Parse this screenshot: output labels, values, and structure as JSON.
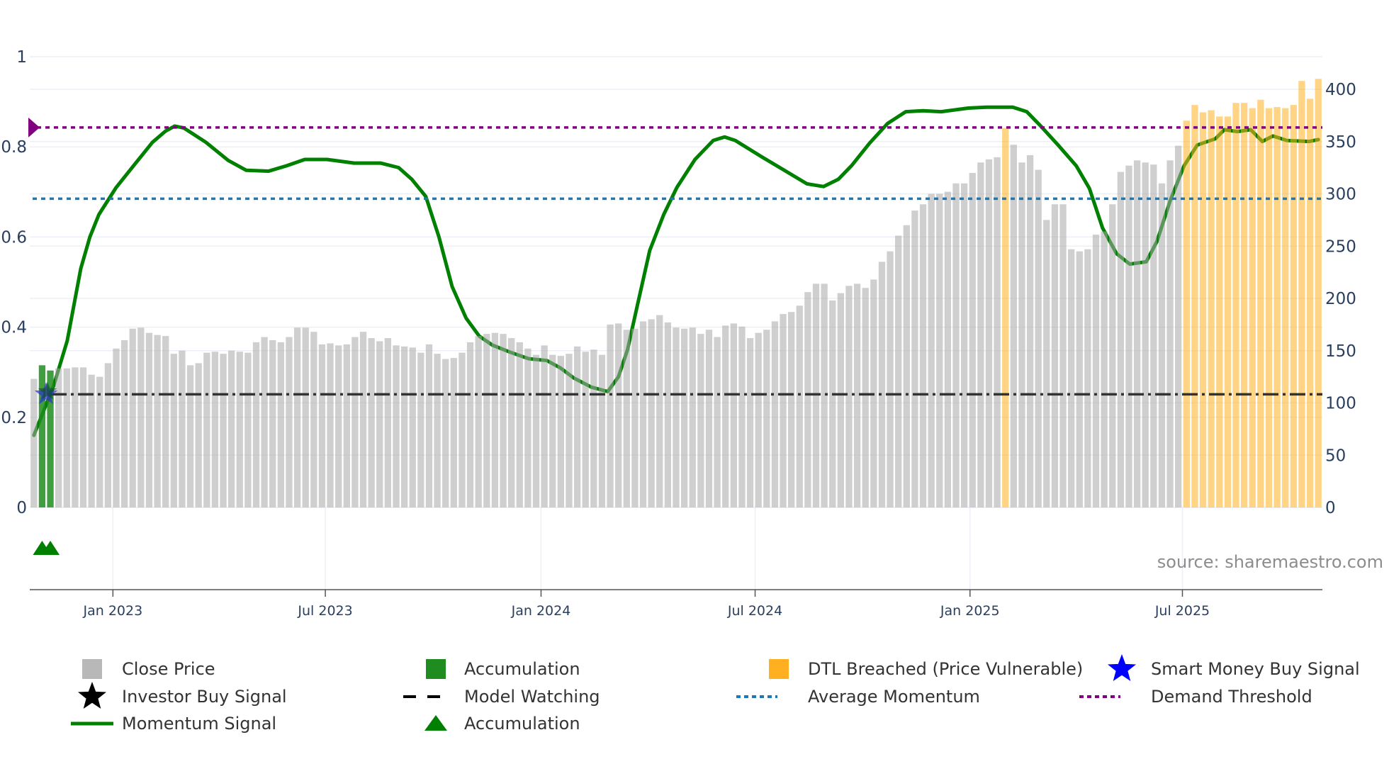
{
  "chart_data": {
    "type": "bar",
    "title": "",
    "source": "source: sharemaestro.com",
    "left_axis": {
      "range": [
        0,
        1
      ],
      "ticks": [
        "0",
        "0.2",
        "0.4",
        "0.6",
        "0.8",
        "1"
      ],
      "tick_values": [
        0,
        0.2,
        0.4,
        0.6,
        0.8,
        1
      ]
    },
    "right_axis": {
      "range": [
        0,
        400
      ],
      "ticks": [
        "0",
        "50",
        "100",
        "150",
        "200",
        "250",
        "300",
        "350",
        "400"
      ],
      "tick_values": [
        0,
        50,
        100,
        150,
        200,
        250,
        300,
        350,
        400
      ]
    },
    "x_ticks": [
      {
        "label": "Jan 2023",
        "index": 9.6
      },
      {
        "label": "Jul 2023",
        "index": 35.4
      },
      {
        "label": "Jan 2024",
        "index": 61.6
      },
      {
        "label": "Jul 2024",
        "index": 87.6
      },
      {
        "label": "Jan 2025",
        "index": 113.7
      },
      {
        "label": "Jul 2025",
        "index": 139.5
      }
    ],
    "close_price": [
      123,
      136,
      131,
      133,
      133,
      134,
      134,
      127,
      125,
      138,
      152,
      160,
      171,
      172,
      167,
      165,
      164,
      147,
      150,
      136,
      138,
      148,
      149,
      147,
      150,
      149,
      148,
      158,
      163,
      160,
      158,
      163,
      172,
      172,
      168,
      156,
      157,
      155,
      156,
      163,
      168,
      162,
      159,
      162,
      155,
      154,
      153,
      148,
      156,
      147,
      142,
      143,
      148,
      158,
      164,
      166,
      167,
      166,
      162,
      158,
      152,
      146,
      155,
      146,
      145,
      147,
      154,
      149,
      151,
      146,
      175,
      176,
      170,
      171,
      178,
      180,
      184,
      177,
      172,
      171,
      172,
      166,
      170,
      163,
      174,
      176,
      173,
      162,
      167,
      170,
      178,
      185,
      187,
      193,
      206,
      214,
      214,
      198,
      205,
      212,
      214,
      210,
      218,
      235,
      245,
      260,
      270,
      284,
      290,
      300,
      300,
      302,
      310,
      310,
      320,
      330,
      333,
      335,
      363,
      347,
      330,
      337,
      323,
      275,
      290,
      290,
      247,
      245,
      247,
      261,
      264,
      290,
      321,
      327,
      332,
      330,
      328,
      310,
      332,
      346,
      370,
      385,
      378,
      380,
      374,
      374,
      387,
      387,
      382,
      390,
      382,
      383,
      382,
      385,
      408,
      391,
      410
    ],
    "accumulation_bars": [
      1,
      2
    ],
    "dtl_breached_bars": [
      118,
      140,
      141,
      142,
      143,
      144,
      145,
      146,
      147,
      148,
      149,
      150,
      151,
      152,
      153,
      154,
      155,
      156
    ],
    "momentum_signal": [
      [
        0,
        0.16
      ],
      [
        2.4,
        0.27
      ],
      [
        4.05,
        0.37
      ],
      [
        5.7,
        0.53
      ],
      [
        6.8,
        0.6
      ],
      [
        7.9,
        0.65
      ],
      [
        10,
        0.71
      ],
      [
        12.2,
        0.76
      ],
      [
        14.4,
        0.81
      ],
      [
        16,
        0.835
      ],
      [
        17.1,
        0.846
      ],
      [
        18.2,
        0.842
      ],
      [
        20.9,
        0.81
      ],
      [
        23.6,
        0.77
      ],
      [
        25.8,
        0.748
      ],
      [
        28.5,
        0.746
      ],
      [
        30.7,
        0.758
      ],
      [
        32.9,
        0.772
      ],
      [
        35.6,
        0.772
      ],
      [
        38.9,
        0.764
      ],
      [
        42.1,
        0.764
      ],
      [
        44.3,
        0.754
      ],
      [
        45.9,
        0.728
      ],
      [
        47.6,
        0.69
      ],
      [
        49.2,
        0.6
      ],
      [
        50.8,
        0.49
      ],
      [
        52.5,
        0.42
      ],
      [
        54.1,
        0.38
      ],
      [
        55.7,
        0.36
      ],
      [
        57.9,
        0.344
      ],
      [
        60.1,
        0.33
      ],
      [
        62.3,
        0.326
      ],
      [
        63.9,
        0.31
      ],
      [
        65.6,
        0.287
      ],
      [
        67.7,
        0.267
      ],
      [
        69.7,
        0.257
      ],
      [
        71,
        0.29
      ],
      [
        72.1,
        0.35
      ],
      [
        73.2,
        0.44
      ],
      [
        74.8,
        0.57
      ],
      [
        76.5,
        0.65
      ],
      [
        78.1,
        0.71
      ],
      [
        80.3,
        0.772
      ],
      [
        82.5,
        0.814
      ],
      [
        83.9,
        0.822
      ],
      [
        85.2,
        0.814
      ],
      [
        88.4,
        0.778
      ],
      [
        91.7,
        0.742
      ],
      [
        93.9,
        0.718
      ],
      [
        95.9,
        0.712
      ],
      [
        97.7,
        0.728
      ],
      [
        99.3,
        0.758
      ],
      [
        101.5,
        0.808
      ],
      [
        103.7,
        0.852
      ],
      [
        105.9,
        0.878
      ],
      [
        108,
        0.88
      ],
      [
        110.2,
        0.878
      ],
      [
        113.5,
        0.886
      ],
      [
        115.7,
        0.888
      ],
      [
        118.9,
        0.888
      ],
      [
        120.6,
        0.878
      ],
      [
        122.2,
        0.848
      ],
      [
        124.4,
        0.804
      ],
      [
        126.6,
        0.758
      ],
      [
        128.2,
        0.708
      ],
      [
        129.8,
        0.62
      ],
      [
        131.5,
        0.563
      ],
      [
        133.1,
        0.54
      ],
      [
        135.1,
        0.545
      ],
      [
        136.4,
        0.59
      ],
      [
        138,
        0.68
      ],
      [
        139.7,
        0.758
      ],
      [
        141.3,
        0.804
      ],
      [
        143.5,
        0.818
      ],
      [
        144.6,
        0.838
      ],
      [
        146.2,
        0.834
      ],
      [
        147.8,
        0.838
      ],
      [
        149.2,
        0.812
      ],
      [
        150.5,
        0.824
      ],
      [
        152.2,
        0.814
      ],
      [
        154.9,
        0.812
      ],
      [
        156,
        0.816
      ]
    ],
    "demand_threshold": 0.843,
    "average_momentum": 0.685,
    "model_watching": 0.251,
    "smart_money_buy_signal": {
      "index": 2,
      "value": 0.251
    },
    "investor_buy_signal": {
      "index": 2,
      "value": 0.251
    },
    "accumulation_markers": [
      1,
      2
    ],
    "legend": [
      {
        "label": "Close Price",
        "symbol": "square",
        "color": "#b8b8b8"
      },
      {
        "label": "Accumulation",
        "symbol": "square",
        "color": "#1e8c1e"
      },
      {
        "label": "DTL Breached (Price Vulnerable)",
        "symbol": "square",
        "color": "#ffb020"
      },
      {
        "label": "Smart Money Buy Signal",
        "symbol": "star",
        "color": "#0000ff"
      },
      {
        "label": "Investor Buy Signal",
        "symbol": "star",
        "color": "#000000"
      },
      {
        "label": "Model Watching",
        "symbol": "dash",
        "color": "#000000"
      },
      {
        "label": "Average Momentum",
        "symbol": "dot",
        "color": "#1f77b4"
      },
      {
        "label": "Demand Threshold",
        "symbol": "dot",
        "color": "#800080"
      },
      {
        "label": "Momentum Signal",
        "symbol": "line",
        "color": "#008000"
      },
      {
        "label": "Accumulation",
        "symbol": "triangle",
        "color": "#008000"
      }
    ],
    "legend_placement": "bottom",
    "colors": {
      "price": "#a0a0a0",
      "accumulation": "#008000",
      "dtl": "#ffa500",
      "momentum": "#008000",
      "avg": "#1f77b4",
      "threshold": "#800080",
      "watch": "#000000",
      "grid": "#eceff5"
    }
  }
}
